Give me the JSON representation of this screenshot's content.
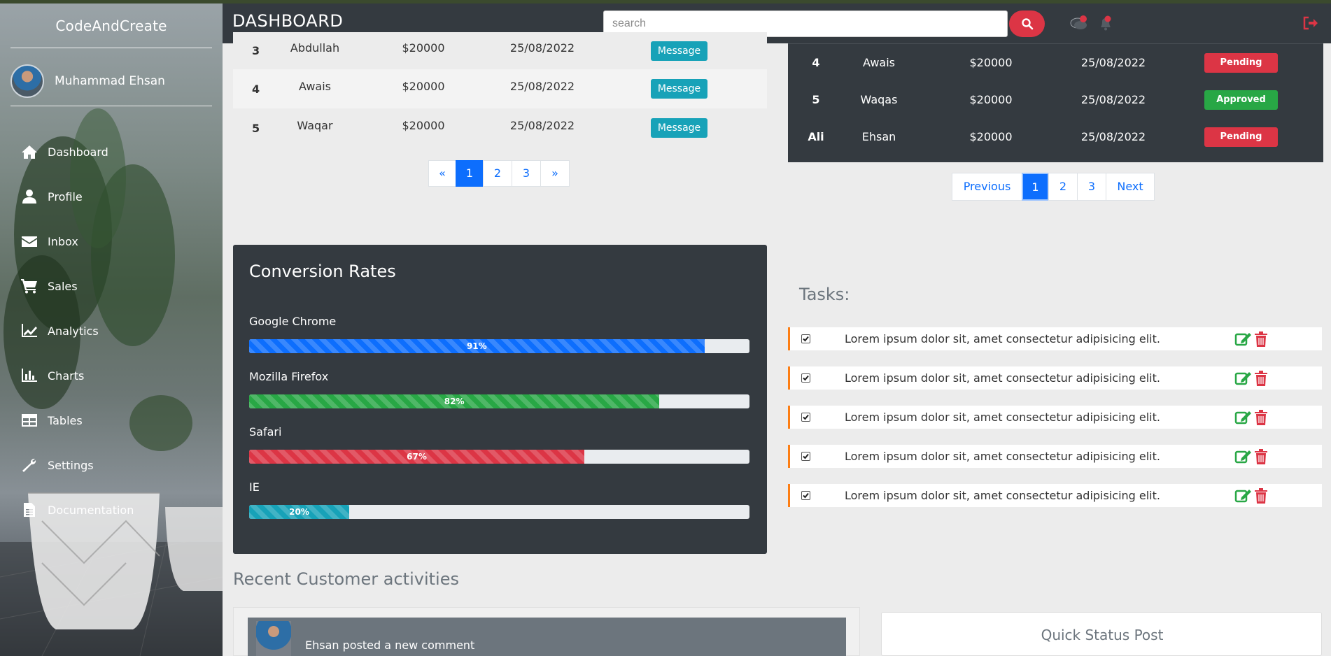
{
  "app": {
    "brand": "CodeAndCreate",
    "page_title": "DASHBOARD"
  },
  "user": {
    "name": "Muhammad Ehsan"
  },
  "sidebar": {
    "items": [
      {
        "label": "Dashboard",
        "icon": "home-icon"
      },
      {
        "label": "Profile",
        "icon": "user-icon"
      },
      {
        "label": "Inbox",
        "icon": "envelope-icon"
      },
      {
        "label": "Sales",
        "icon": "cart-icon"
      },
      {
        "label": "Analytics",
        "icon": "line-chart-icon"
      },
      {
        "label": "Charts",
        "icon": "bar-chart-icon"
      },
      {
        "label": "Tables",
        "icon": "table-icon"
      },
      {
        "label": "Settings",
        "icon": "wrench-icon"
      },
      {
        "label": "Documentation",
        "icon": "file-icon"
      }
    ]
  },
  "header": {
    "search_placeholder": "search",
    "icons": [
      "search-icon",
      "comments-icon",
      "bell-icon",
      "sign-out-icon"
    ],
    "accent": "#dc3545"
  },
  "left_table": {
    "rows": [
      {
        "id": "3",
        "name": "Abdullah",
        "amount": "$20000",
        "date": "25/08/2022",
        "action": "Message"
      },
      {
        "id": "4",
        "name": "Awais",
        "amount": "$20000",
        "date": "25/08/2022",
        "action": "Message"
      },
      {
        "id": "5",
        "name": "Waqar",
        "amount": "$20000",
        "date": "25/08/2022",
        "action": "Message"
      }
    ],
    "pagination": [
      "«",
      "1",
      "2",
      "3",
      "»"
    ],
    "active_page": "1"
  },
  "right_table": {
    "rows": [
      {
        "id": "4",
        "name": "Awais",
        "amount": "$20000",
        "date": "25/08/2022",
        "status": "Pending",
        "status_color": "#dc3545"
      },
      {
        "id": "5",
        "name": "Waqas",
        "amount": "$20000",
        "date": "25/08/2022",
        "status": "Approved",
        "status_color": "#28a745"
      },
      {
        "id": "Ali",
        "name": "Ehsan",
        "amount": "$20000",
        "date": "25/08/2022",
        "status": "Pending",
        "status_color": "#dc3545"
      }
    ],
    "pagination": [
      "Previous",
      "1",
      "2",
      "3",
      "Next"
    ],
    "active_page": "1"
  },
  "conversion": {
    "title": "Conversion Rates",
    "bars": [
      {
        "label": "Google Chrome",
        "percent": 91,
        "percent_text": "91%",
        "color": "#0d6efd"
      },
      {
        "label": "Mozilla Firefox",
        "percent": 82,
        "percent_text": "82%",
        "color": "#28a745"
      },
      {
        "label": "Safari",
        "percent": 67,
        "percent_text": "67%",
        "color": "#dc3545"
      },
      {
        "label": "IE",
        "percent": 20,
        "percent_text": "20%",
        "color": "#17a2b8"
      }
    ]
  },
  "tasks": {
    "title": "Tasks:",
    "items": [
      {
        "text": "Lorem ipsum dolor sit, amet consectetur adipisicing elit.",
        "checked": true
      },
      {
        "text": "Lorem ipsum dolor sit, amet consectetur adipisicing elit.",
        "checked": true
      },
      {
        "text": "Lorem ipsum dolor sit, amet consectetur adipisicing elit.",
        "checked": true
      },
      {
        "text": "Lorem ipsum dolor sit, amet consectetur adipisicing elit.",
        "checked": true
      },
      {
        "text": "Lorem ipsum dolor sit, amet consectetur adipisicing elit.",
        "checked": true
      }
    ]
  },
  "recent": {
    "title": "Recent Customer activities",
    "activity_text": "Ehsan posted a new comment"
  },
  "quick_status": {
    "title": "Quick Status Post"
  }
}
